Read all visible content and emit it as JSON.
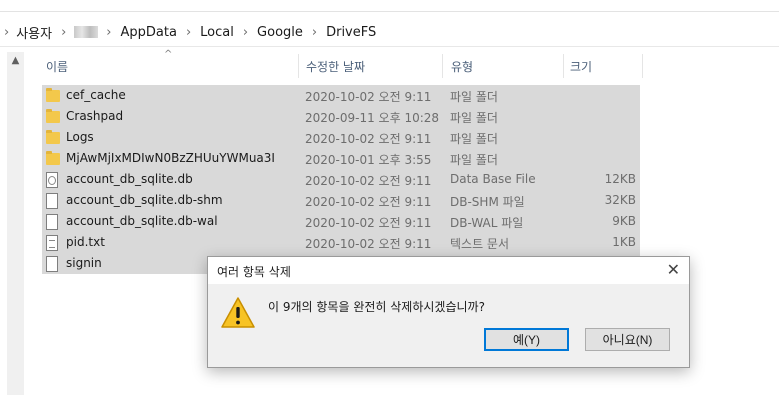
{
  "breadcrumb": {
    "items": [
      "사용자",
      "AppData",
      "Local",
      "Google",
      "DriveFS"
    ]
  },
  "columns": {
    "name": "이름",
    "modified": "수정한 날짜",
    "type": "유형",
    "size": "크기"
  },
  "files": [
    {
      "name": "cef_cache",
      "date": "2020-10-02 오전 9:11",
      "type": "파일 폴더",
      "size": "",
      "icon": "folder-icon"
    },
    {
      "name": "Crashpad",
      "date": "2020-09-11 오후 10:28",
      "type": "파일 폴더",
      "size": "",
      "icon": "folder-icon"
    },
    {
      "name": "Logs",
      "date": "2020-10-02 오전 9:11",
      "type": "파일 폴더",
      "size": "",
      "icon": "folder-icon"
    },
    {
      "name": "MjAwMjIxMDIwN0BzZHUuYWMua3I",
      "date": "2020-10-01 오후 3:55",
      "type": "파일 폴더",
      "size": "",
      "icon": "folder-icon"
    },
    {
      "name": "account_db_sqlite.db",
      "date": "2020-10-02 오전 9:11",
      "type": "Data Base File",
      "size": "12KB",
      "icon": "database-file-icon"
    },
    {
      "name": "account_db_sqlite.db-shm",
      "date": "2020-10-02 오전 9:11",
      "type": "DB-SHM 파일",
      "size": "32KB",
      "icon": "file-icon"
    },
    {
      "name": "account_db_sqlite.db-wal",
      "date": "2020-10-02 오전 9:11",
      "type": "DB-WAL 파일",
      "size": "9KB",
      "icon": "file-icon"
    },
    {
      "name": "pid.txt",
      "date": "2020-10-02 오전 9:11",
      "type": "텍스트 문서",
      "size": "1KB",
      "icon": "text-file-icon"
    },
    {
      "name": "signin",
      "date": "",
      "type": "",
      "size": "",
      "icon": "file-icon"
    }
  ],
  "dialog": {
    "title": "여러 항목 삭제",
    "message": "이 9개의 항목을 완전히 삭제하시겠습니까?",
    "yes_label": "예(Y)",
    "no_label": "아니요(N)",
    "icon": "warning-icon"
  },
  "colors": {
    "selection": "#d9d9d9",
    "folder": "#f3c84b",
    "header_text": "#4c607a",
    "warning": "#f7c325"
  }
}
